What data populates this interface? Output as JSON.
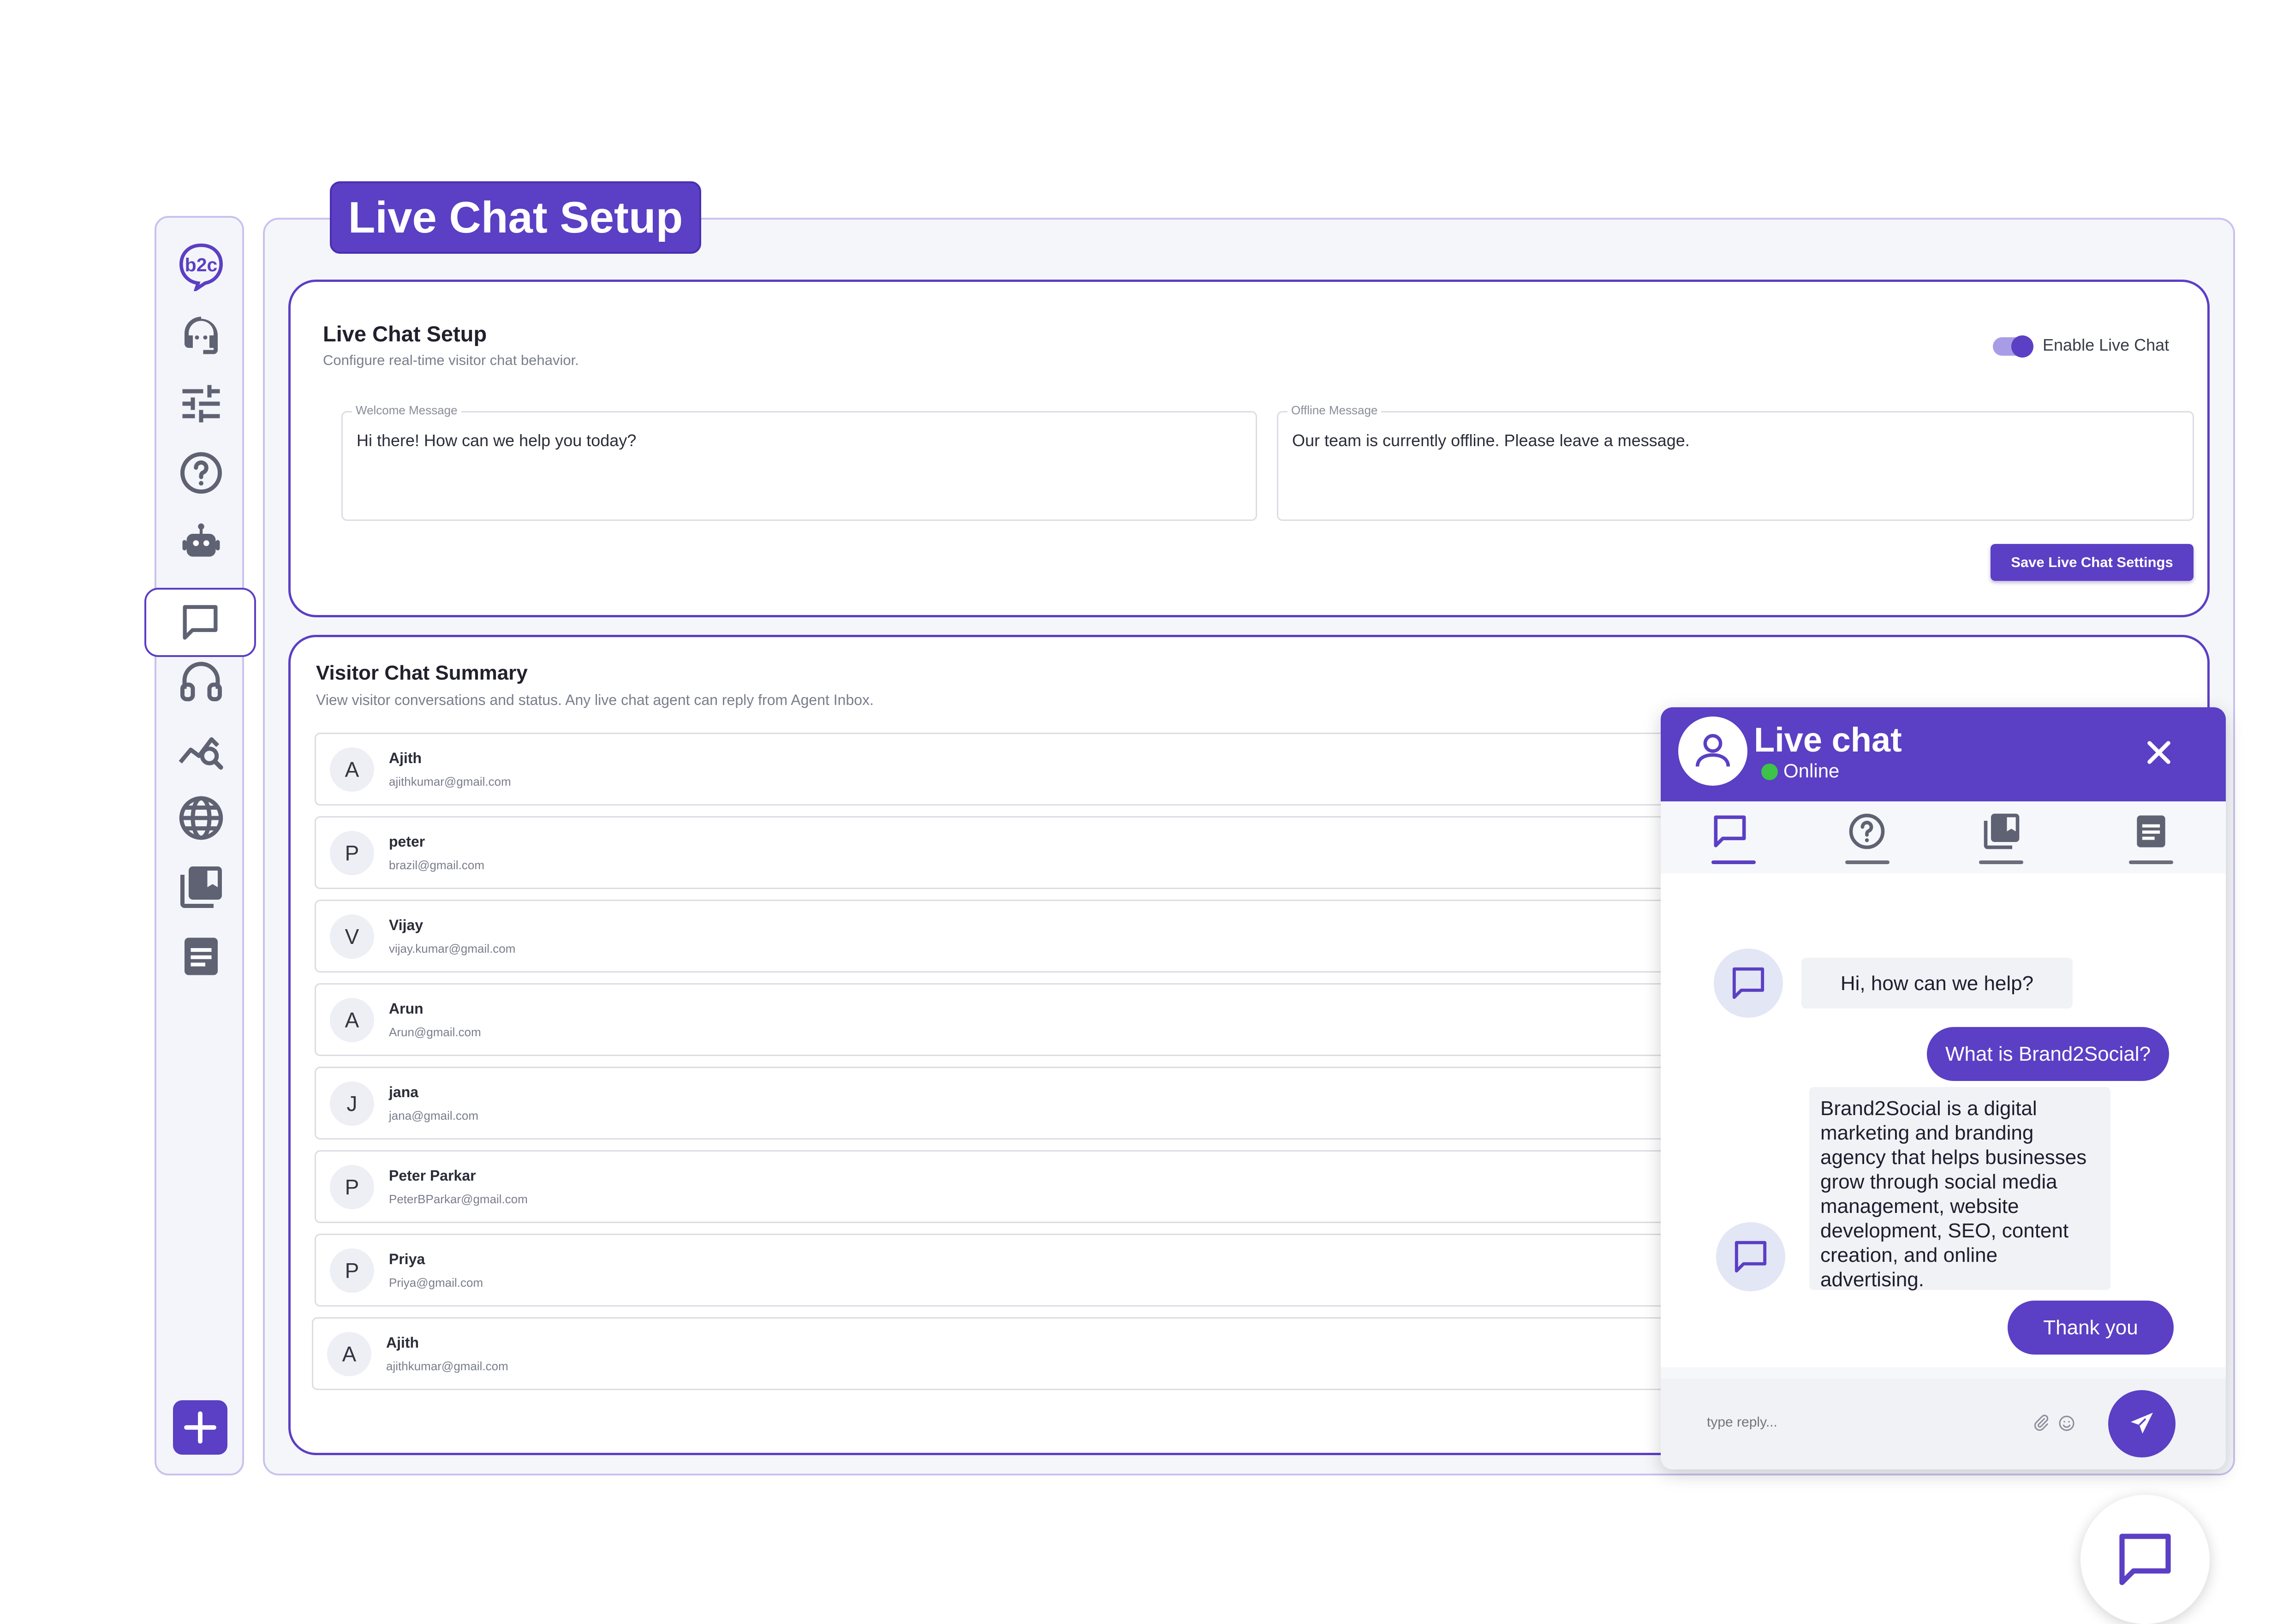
{
  "page": {
    "title": "Live Chat Setup"
  },
  "sidebar": {
    "logo": "b2c",
    "icons": [
      "logo-icon",
      "support-agent-icon",
      "sliders-icon",
      "help-icon",
      "robot-icon",
      "chat-icon",
      "headphones-icon",
      "analytics-search-icon",
      "globe-icon",
      "library-icon",
      "document-icon",
      "add-icon"
    ],
    "active": "chat-icon"
  },
  "setup": {
    "title": "Live Chat Setup",
    "subtitle": "Configure real-time visitor chat behavior.",
    "toggle_label": "Enable Live Chat",
    "toggle_on": true,
    "welcome_label": "Welcome Message",
    "welcome_value": "Hi there! How can we help you today?",
    "offline_label": "Offline Message",
    "offline_value": "Our team is currently offline. Please leave a message.",
    "save_label": "Save Live Chat Settings"
  },
  "summary": {
    "title": "Visitor Chat Summary",
    "subtitle": "View visitor conversations and status. Any live chat agent can reply from Agent Inbox.",
    "visitors": [
      {
        "initial": "A",
        "name": "Ajith",
        "email": "ajithkumar@gmail.com"
      },
      {
        "initial": "P",
        "name": "peter",
        "email": "brazil@gmail.com"
      },
      {
        "initial": "V",
        "name": "Vijay",
        "email": "vijay.kumar@gmail.com"
      },
      {
        "initial": "A",
        "name": "Arun",
        "email": "Arun@gmail.com"
      },
      {
        "initial": "J",
        "name": "jana",
        "email": "jana@gmail.com"
      },
      {
        "initial": "P",
        "name": "Peter Parkar",
        "email": "PeterBParkar@gmail.com"
      },
      {
        "initial": "P",
        "name": "Priya",
        "email": "Priya@gmail.com"
      },
      {
        "initial": "A",
        "name": "Ajith",
        "email": "ajithkumar@gmail.com"
      }
    ]
  },
  "chat": {
    "title": "Live chat",
    "status": "Online",
    "status_color": "#3dc24a",
    "tabs": [
      "chat-tab-icon",
      "help-tab-icon",
      "library-tab-icon",
      "document-tab-icon"
    ],
    "messages": {
      "bot1": "Hi, how can we help?",
      "user1": "What is Brand2Social?",
      "bot2": "Brand2Social is a digital marketing and branding agency that helps businesses grow through social media management, website development, SEO, content creation, and online advertising.",
      "user2": "Thank you"
    },
    "input_placeholder": "type reply..."
  },
  "colors": {
    "accent": "#5b3fc4",
    "border": "#c9c2ee"
  }
}
